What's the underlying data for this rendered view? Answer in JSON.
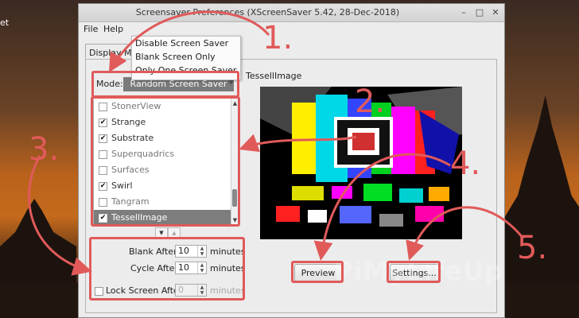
{
  "desktop": {
    "label": "et",
    "watermark": "PiMyLifeUp"
  },
  "window": {
    "title": "Screensaver Preferences  (XScreenSaver 5.42, 28-Dec-2018)",
    "buttons": {
      "minimize": "–",
      "maximize": "□",
      "close": "✕"
    }
  },
  "menu": {
    "file": "File",
    "help": "Help"
  },
  "tab": {
    "label": "Display Modes"
  },
  "mode": {
    "label": "Mode:",
    "selected": "Random Screen Saver",
    "options": [
      "Disable Screen Saver",
      "Blank Screen Only",
      "Only One Screen Saver"
    ]
  },
  "list": {
    "items": [
      {
        "name": "StonerView",
        "checked": false,
        "selected": false
      },
      {
        "name": "Strange",
        "checked": true,
        "selected": false
      },
      {
        "name": "Substrate",
        "checked": true,
        "selected": false
      },
      {
        "name": "Superquadrics",
        "checked": false,
        "selected": false
      },
      {
        "name": "Surfaces",
        "checked": false,
        "selected": false
      },
      {
        "name": "Swirl",
        "checked": true,
        "selected": false
      },
      {
        "name": "Tangram",
        "checked": false,
        "selected": false
      },
      {
        "name": "TessellImage",
        "checked": true,
        "selected": true
      }
    ],
    "scroll_up": "▲",
    "scroll_down": "▼",
    "check_mark": "✔"
  },
  "nav": {
    "down": "▼",
    "up": "▲"
  },
  "timing": {
    "blank_after_label": "Blank After",
    "blank_after_value": "10",
    "cycle_after_label": "Cycle After",
    "cycle_after_value": "10",
    "lock_label": "Lock Screen After",
    "lock_value": "0",
    "unit": "minutes"
  },
  "preview": {
    "title": "TessellImage"
  },
  "buttons": {
    "preview": "Preview",
    "settings": "Settings..."
  },
  "annotations": {
    "n1": "1.",
    "n2": "2.",
    "n3": "3.",
    "n4": "4.",
    "n5": "5."
  },
  "colors": {
    "annotation": "#e05a5a",
    "selection": "#7d7d7d"
  }
}
